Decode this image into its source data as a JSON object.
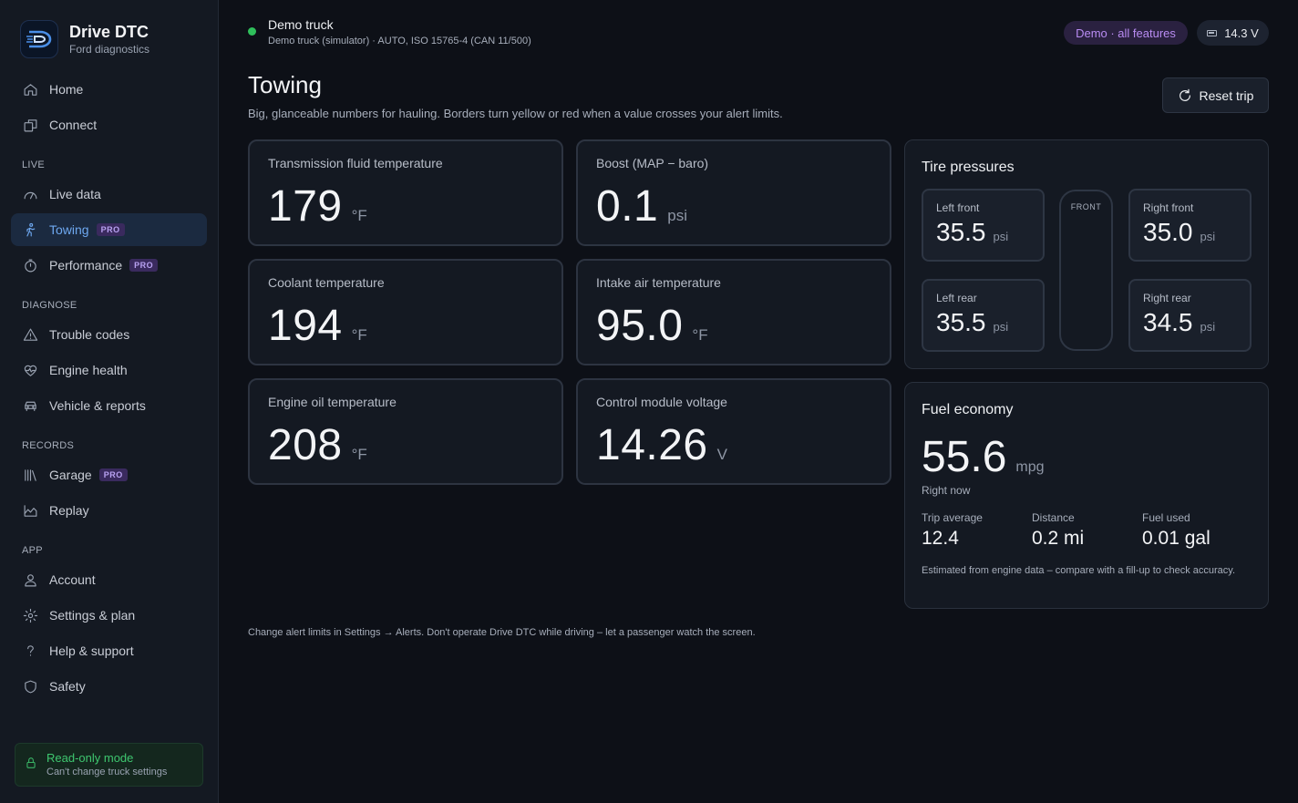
{
  "brand": {
    "title": "Drive DTC",
    "subtitle": "Ford diagnostics"
  },
  "sidebar": {
    "top": [
      {
        "label": "Home",
        "icon": "home-icon"
      },
      {
        "label": "Connect",
        "icon": "connect-icon"
      }
    ],
    "sections": [
      {
        "label": "LIVE",
        "items": [
          {
            "label": "Live data",
            "icon": "gauge-icon"
          },
          {
            "label": "Towing",
            "icon": "towing-icon",
            "badge": "PRO",
            "active": true
          },
          {
            "label": "Performance",
            "icon": "stopwatch-icon",
            "badge": "PRO"
          }
        ]
      },
      {
        "label": "DIAGNOSE",
        "items": [
          {
            "label": "Trouble codes",
            "icon": "warning-icon"
          },
          {
            "label": "Engine health",
            "icon": "heart-pulse-icon"
          },
          {
            "label": "Vehicle & reports",
            "icon": "car-icon"
          }
        ]
      },
      {
        "label": "RECORDS",
        "items": [
          {
            "label": "Garage",
            "icon": "library-icon",
            "badge": "PRO"
          },
          {
            "label": "Replay",
            "icon": "chart-area-icon"
          }
        ]
      },
      {
        "label": "APP",
        "items": [
          {
            "label": "Account",
            "icon": "user-icon"
          },
          {
            "label": "Settings & plan",
            "icon": "gear-icon"
          },
          {
            "label": "Help & support",
            "icon": "question-icon"
          },
          {
            "label": "Safety",
            "icon": "shield-icon"
          }
        ]
      }
    ],
    "readonly": {
      "title": "Read-only mode",
      "subtitle": "Can't change truck settings"
    }
  },
  "header": {
    "vehicle_name": "Demo truck",
    "vehicle_detail": "Demo truck (simulator) · AUTO, ISO 15765-4 (CAN 11/500)",
    "status_color": "#2fbf5b",
    "demo_label": "Demo · all features",
    "voltage": "14.3 V"
  },
  "page": {
    "title": "Towing",
    "subtitle": "Big, glanceable numbers for hauling. Borders turn yellow or red when a value crosses your alert limits.",
    "reset_label": "Reset trip"
  },
  "metrics": [
    {
      "label": "Transmission fluid temperature",
      "value": "179",
      "unit": "°F"
    },
    {
      "label": "Boost (MAP − baro)",
      "value": "0.1",
      "unit": "psi"
    },
    {
      "label": "Coolant temperature",
      "value": "194",
      "unit": "°F"
    },
    {
      "label": "Intake air temperature",
      "value": "95.0",
      "unit": "°F"
    },
    {
      "label": "Engine oil temperature",
      "value": "208",
      "unit": "°F"
    },
    {
      "label": "Control module voltage",
      "value": "14.26",
      "unit": "V"
    }
  ],
  "tires": {
    "title": "Tire pressures",
    "front_label": "FRONT",
    "items": [
      {
        "label": "Left front",
        "value": "35.5",
        "unit": "psi"
      },
      {
        "label": "Right front",
        "value": "35.0",
        "unit": "psi"
      },
      {
        "label": "Left rear",
        "value": "35.5",
        "unit": "psi"
      },
      {
        "label": "Right rear",
        "value": "34.5",
        "unit": "psi"
      }
    ]
  },
  "fuel": {
    "title": "Fuel economy",
    "value": "55.6",
    "unit": "mpg",
    "now_label": "Right now",
    "stats": [
      {
        "label": "Trip average",
        "value": "12.4"
      },
      {
        "label": "Distance",
        "value": "0.2 mi"
      },
      {
        "label": "Fuel used",
        "value": "0.01 gal"
      }
    ],
    "note": "Estimated from engine data – compare with a fill-up to check accuracy."
  },
  "footer_note": "Change alert limits in Settings → Alerts. Don't operate Drive DTC while driving – let a passenger watch the screen."
}
